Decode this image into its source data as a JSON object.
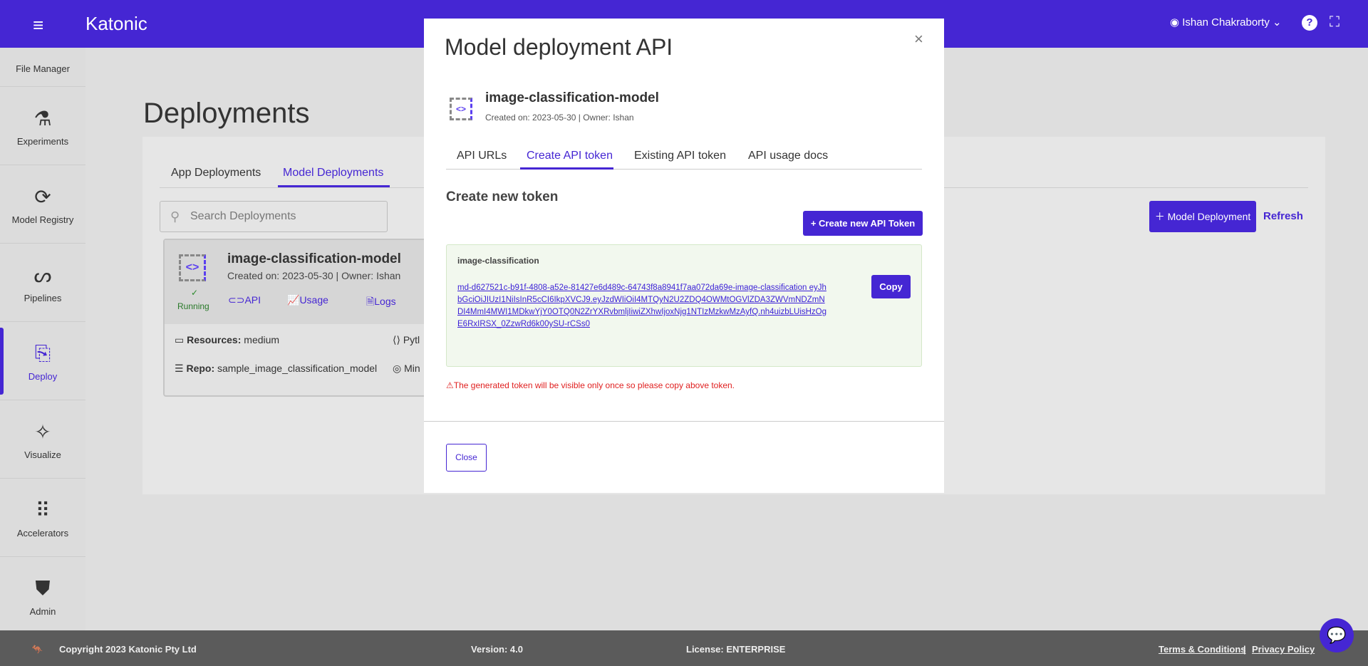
{
  "header": {
    "brand": "Katonic",
    "user": "Ishan Chakraborty",
    "brand_color": "#4526d3"
  },
  "sidebar": {
    "items": [
      {
        "label": "File Manager",
        "icon": "folder-icon"
      },
      {
        "label": "Experiments",
        "icon": "flask-icon"
      },
      {
        "label": "Model Registry",
        "icon": "registry-icon"
      },
      {
        "label": "Pipelines",
        "icon": "pipeline-icon"
      },
      {
        "label": "Deploy",
        "icon": "deploy-icon",
        "active": true
      },
      {
        "label": "Visualize",
        "icon": "sparkle-chart-icon"
      },
      {
        "label": "Accelerators",
        "icon": "grid-icon"
      },
      {
        "label": "Admin",
        "icon": "shield-user-icon"
      }
    ]
  },
  "page": {
    "title": "Deployments",
    "tabs": [
      "App Deployments",
      "Model Deployments"
    ],
    "active_tab": "Model Deployments",
    "search_placeholder": "Search Deployments",
    "add_button": "Model Deployment",
    "refresh": "Refresh"
  },
  "card": {
    "name": "image-classification-model",
    "meta": "Created on: 2023-05-30 | Owner: Ishan",
    "status": "Running",
    "links": [
      "API",
      "Usage",
      "Logs"
    ],
    "resources_label": "Resources:",
    "resources": "medium",
    "repo_label": "Repo:",
    "repo": "sample_image_classification_model",
    "lang_partial": "Pytl",
    "min_partial": "Min"
  },
  "modal": {
    "title": "Model deployment API",
    "model_name": "image-classification-model",
    "meta": "Created on: 2023-05-30 | Owner: Ishan",
    "tabs": [
      "API URLs",
      "Create API token",
      "Existing API token",
      "API usage docs"
    ],
    "active_tab": "Create API token",
    "section_title": "Create new token",
    "create_button": "+ Create new API Token",
    "token_name": "image-classification",
    "token": "md-d627521c-b91f-4808-a52e-81427e6d489c-64743f8a8941f7aa072da69e-image-classification eyJhbGciOiJIUzI1NiIsInR5cCI6IkpXVCJ9.eyJzdWIiOiI4MTQyN2U2ZDQ4OWMtOGVlZDA3ZWVmNDZmNDI4MmI4MWI1MDkwYjY0OTQ0N2ZrYXRvbmljIiwiZXhwIjoxNjg1NTIzMzkwMzAyfQ.nh4uizbLUisHzOgE6RxIRSX_0ZzwRd6k00ySU-rCSs0",
    "copy": "Copy",
    "warning": "The generated token will be visible only once so please copy above token.",
    "close": "Close"
  },
  "footer": {
    "copyright": "Copyright 2023 Katonic Pty Ltd",
    "version": "Version: 4.0",
    "license": "License: ENTERPRISE",
    "terms": "Terms & Conditions",
    "sep": "|",
    "privacy": "Privacy Policy"
  }
}
